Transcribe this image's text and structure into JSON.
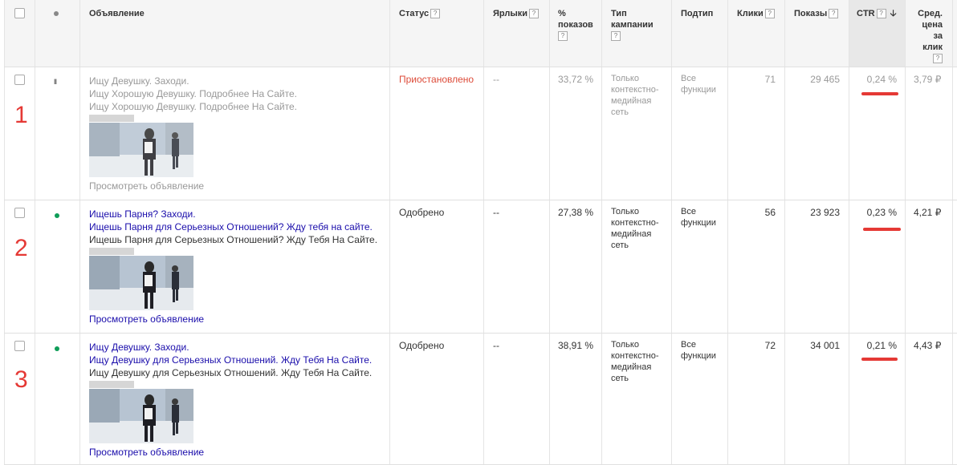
{
  "header": {
    "ad": "Объявление",
    "status": "Статус",
    "labels": "Ярлыки",
    "pct_impr": [
      "%",
      "показов"
    ],
    "campaign_type": [
      "Тип",
      "кампании"
    ],
    "subtype": "Подтип",
    "clicks": "Клики",
    "impressions": "Показы",
    "ctr": "CTR",
    "avg_cpc": [
      "Сред.",
      "цена",
      "за",
      "клик"
    ],
    "help": "?",
    "sort_arrow": "🡣"
  },
  "rows": [
    {
      "number": "1",
      "state_icon": "pause-icon",
      "headline": "Ищу Девушку. Заходи.",
      "line1": "Ищу Хорошую Девушку. Подробнее На Сайте.",
      "line2": "Ищу Хорошую Девушку. Подробнее На Сайте.",
      "view_link": "Просмотреть объявление",
      "status": "Приостановлено",
      "labels": "--",
      "pct_impr": "33,72 %",
      "campaign_type": [
        "Только",
        "контекстно-",
        "медийная",
        "сеть"
      ],
      "subtype": [
        "Все",
        "функции"
      ],
      "clicks": "71",
      "impressions": "29 465",
      "ctr": "0,24 %",
      "avg_cpc": "3,79 ₽"
    },
    {
      "number": "2",
      "state_icon": "enabled-dot-icon",
      "headline": "Ищешь Парня? Заходи.",
      "line1": "Ищешь Парня для Серьезных Отношений? Жду тебя на сайте.",
      "line2": "Ищешь Парня для Серьезных Отношений? Жду Тебя На Сайте.",
      "view_link": "Просмотреть объявление",
      "status": "Одобрено",
      "labels": "--",
      "pct_impr": "27,38 %",
      "campaign_type": [
        "Только",
        "контекстно-",
        "медийная",
        "сеть"
      ],
      "subtype": [
        "Все",
        "функции"
      ],
      "clicks": "56",
      "impressions": "23 923",
      "ctr": "0,23 %",
      "avg_cpc": "4,21 ₽"
    },
    {
      "number": "3",
      "state_icon": "enabled-dot-icon",
      "headline": "Ищу Девушку. Заходи.",
      "line1": "Ищу Девушку для Серьезных Отношений. Жду Тебя На Сайте.",
      "line2": "Ищу Девушку для Серьезных Отношений. Жду Тебя На Сайте.",
      "view_link": "Просмотреть объявление",
      "status": "Одобрено",
      "labels": "--",
      "pct_impr": "38,91 %",
      "campaign_type": [
        "Только",
        "контекстно-",
        "медийная",
        "сеть"
      ],
      "subtype": [
        "Все",
        "функции"
      ],
      "clicks": "72",
      "impressions": "34 001",
      "ctr": "0,21 %",
      "avg_cpc": "4,43 ₽"
    }
  ],
  "colors": {
    "link": "#1a0dab",
    "paused": "#dd4b39",
    "enabled": "#0f9d58",
    "annotation": "#e53935"
  }
}
